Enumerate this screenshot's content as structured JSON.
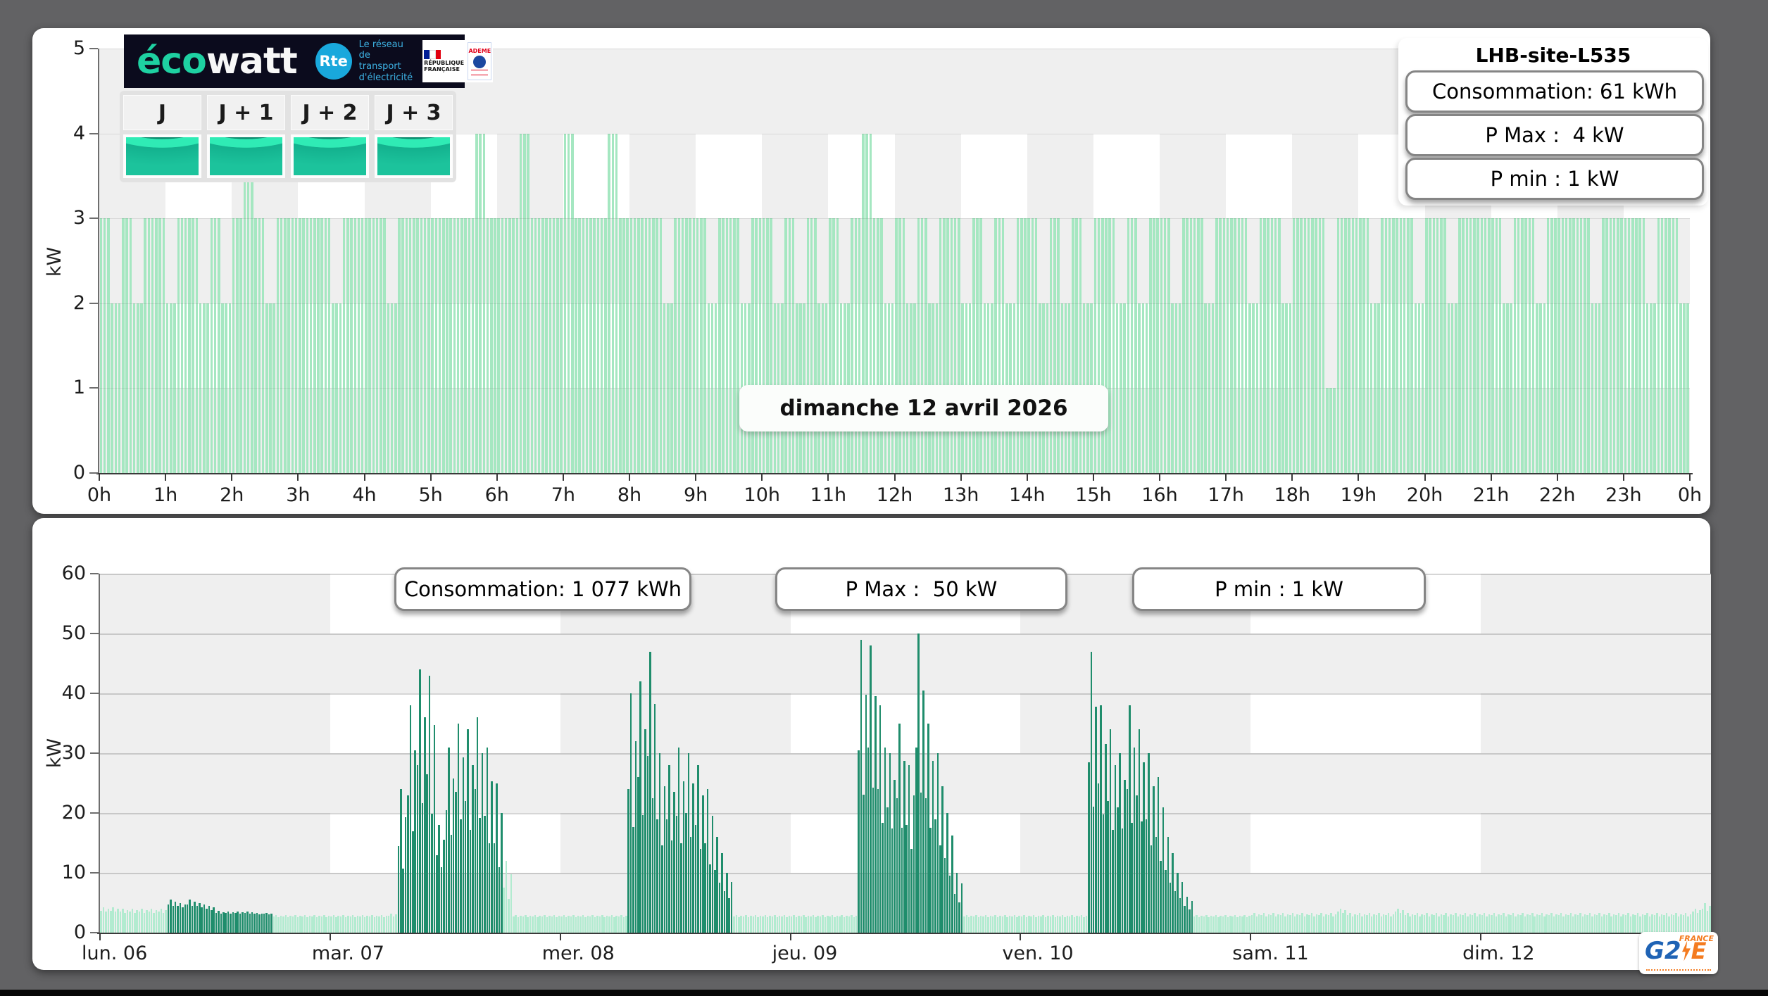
{
  "colors": {
    "checker_gray": "#efefef",
    "accent_teal": "#1ed1a2",
    "rte_blue": "#19a8dc",
    "top_bar_green": "#a5e7c1",
    "light_green": "#b2ebd0",
    "dark_green": "#1f8d6c"
  },
  "logo_banner": {
    "brand_eco": "éco",
    "brand_watt": "watt",
    "rte": "Rte",
    "rte_tagline": "Le réseau\nde transport\nd'électricité",
    "republique": "RÉPUBLIQUE FRANÇAISE",
    "ademe": "ADEME"
  },
  "day_selector": {
    "buttons": [
      "J",
      "J + 1",
      "J + 2",
      "J + 3"
    ]
  },
  "g2e": {
    "g2": "G2",
    "e": "E",
    "france": "FRANCE"
  },
  "chart_data": [
    {
      "type": "bar",
      "title": "LHB-site-L535",
      "annotation": "dimanche 12 avril 2026",
      "ylabel": "kW",
      "ylim": [
        0,
        5
      ],
      "ytick_labels": [
        "5",
        "4",
        "3",
        "2",
        "1",
        "0"
      ],
      "xtick_labels": [
        "0h",
        "1h",
        "2h",
        "3h",
        "4h",
        "5h",
        "6h",
        "7h",
        "8h",
        "9h",
        "10h",
        "11h",
        "12h",
        "13h",
        "14h",
        "15h",
        "16h",
        "17h",
        "18h",
        "19h",
        "20h",
        "21h",
        "22h",
        "23h",
        "0h"
      ],
      "x_step_minutes": 10,
      "bar_color": "#a5e7c1",
      "stats": {
        "consumption": "Consommation: 61 kWh",
        "pmax": "P Max :  4 kW",
        "pmin": "P min : 1 kW"
      },
      "values": [
        3,
        2,
        3,
        2,
        3,
        3,
        2,
        3,
        3,
        2,
        3,
        2,
        3,
        4,
        3,
        2,
        3,
        3,
        3,
        3,
        3,
        2,
        3,
        3,
        3,
        3,
        2,
        3,
        3,
        3,
        3,
        3,
        3,
        3,
        4,
        3,
        3,
        3,
        4,
        3,
        3,
        3,
        4,
        3,
        3,
        3,
        4,
        3,
        3,
        3,
        3,
        2,
        3,
        3,
        3,
        2,
        3,
        3,
        2,
        3,
        3,
        2,
        3,
        2,
        3,
        2,
        3,
        2,
        3,
        4,
        3,
        2,
        3,
        2,
        3,
        2,
        3,
        3,
        2,
        3,
        2,
        3,
        2,
        3,
        3,
        2,
        3,
        2,
        3,
        2,
        3,
        3,
        2,
        3,
        2,
        3,
        3,
        2,
        3,
        3,
        2,
        3,
        3,
        3,
        2,
        3,
        3,
        2,
        3,
        3,
        3,
        1,
        3,
        3,
        3,
        2,
        3,
        3,
        3,
        2,
        3,
        3,
        2,
        3,
        3,
        3,
        3,
        2,
        3,
        3,
        2,
        3,
        3,
        3,
        3,
        2,
        3,
        3,
        3,
        3,
        2,
        3,
        3,
        2
      ]
    },
    {
      "type": "bar",
      "ylabel": "kW",
      "ylim": [
        0,
        60
      ],
      "ytick_labels": [
        "60",
        "50",
        "40",
        "30",
        "20",
        "10",
        "0"
      ],
      "stats": {
        "consumption": "Consommation: 1 077 kWh",
        "pmax": "P Max :  50 kW",
        "pmin": "P min : 1 kW"
      },
      "colors": {
        "light": "#b2ebd0",
        "dark": "#1f8d6c"
      },
      "sub_pattern": [
        0.5,
        1,
        0.3,
        0.75
      ],
      "days": [
        {
          "label": "lun. 06",
          "hours": [
            [
              3.2,
              4.2,
              "L"
            ],
            [
              3.2,
              4.2,
              "L"
            ],
            [
              3,
              4,
              "L"
            ],
            [
              3,
              4,
              "L"
            ],
            [
              3,
              4,
              "L"
            ],
            [
              3,
              4,
              "L"
            ],
            [
              3,
              4,
              "L"
            ],
            [
              4,
              5.5,
              "D"
            ],
            [
              4,
              5,
              "D"
            ],
            [
              4,
              5.5,
              "D"
            ],
            [
              4,
              5,
              "D"
            ],
            [
              3.5,
              4.5,
              "D"
            ],
            [
              3,
              3.6,
              "D"
            ],
            [
              3,
              3.5,
              "D"
            ],
            [
              3,
              3.5,
              "D"
            ],
            [
              3,
              3.5,
              "D"
            ],
            [
              3,
              3.3,
              "D"
            ],
            [
              3,
              3.3,
              "D"
            ],
            [
              2.5,
              3,
              "L"
            ],
            [
              2.5,
              3,
              "L"
            ],
            [
              2.5,
              3,
              "L"
            ],
            [
              2.5,
              3,
              "L"
            ],
            [
              2.5,
              3,
              "L"
            ],
            [
              2.5,
              3,
              "L"
            ]
          ]
        },
        {
          "label": "mar. 07",
          "hours": [
            [
              2.5,
              3,
              "L"
            ],
            [
              2.5,
              3,
              "L"
            ],
            [
              2.5,
              3,
              "L"
            ],
            [
              2.5,
              3,
              "L"
            ],
            [
              2.5,
              3,
              "L"
            ],
            [
              2.5,
              3,
              "L"
            ],
            [
              2.5,
              3.2,
              "L"
            ],
            [
              5,
              24,
              "D"
            ],
            [
              8,
              38,
              "D"
            ],
            [
              12,
              44,
              "D"
            ],
            [
              10,
              43,
              "D"
            ],
            [
              8,
              18,
              "D"
            ],
            [
              10,
              31,
              "D"
            ],
            [
              12,
              35,
              "D"
            ],
            [
              10,
              34,
              "D"
            ],
            [
              12,
              36,
              "D"
            ],
            [
              8,
              31,
              "D"
            ],
            [
              5,
              25,
              "D"
            ],
            [
              3,
              12,
              "L"
            ],
            [
              2.5,
              3,
              "L"
            ],
            [
              2.5,
              3,
              "L"
            ],
            [
              2.5,
              3,
              "L"
            ],
            [
              2.5,
              3,
              "L"
            ],
            [
              2.5,
              3,
              "L"
            ]
          ]
        },
        {
          "label": "mer. 08",
          "hours": [
            [
              2.5,
              3,
              "L"
            ],
            [
              2.5,
              3,
              "L"
            ],
            [
              2.5,
              3,
              "L"
            ],
            [
              2.5,
              3,
              "L"
            ],
            [
              2.5,
              3,
              "L"
            ],
            [
              2.5,
              3,
              "L"
            ],
            [
              2.5,
              3,
              "L"
            ],
            [
              8,
              40,
              "D"
            ],
            [
              10,
              42,
              "D"
            ],
            [
              12,
              47,
              "D"
            ],
            [
              8,
              30,
              "D"
            ],
            [
              10,
              28,
              "D"
            ],
            [
              8,
              31,
              "D"
            ],
            [
              10,
              30,
              "D"
            ],
            [
              8,
              28,
              "D"
            ],
            [
              6,
              24,
              "D"
            ],
            [
              5,
              16,
              "D"
            ],
            [
              4,
              10,
              "D"
            ],
            [
              2.5,
              3,
              "L"
            ],
            [
              2.5,
              3,
              "L"
            ],
            [
              2.5,
              3,
              "L"
            ],
            [
              2.5,
              3,
              "L"
            ],
            [
              2.5,
              3,
              "L"
            ],
            [
              2.5,
              3,
              "L"
            ]
          ]
        },
        {
          "label": "jeu. 09",
          "hours": [
            [
              2.5,
              3,
              "L"
            ],
            [
              2.5,
              3,
              "L"
            ],
            [
              2.5,
              3,
              "L"
            ],
            [
              2.5,
              3,
              "L"
            ],
            [
              2.5,
              3,
              "L"
            ],
            [
              2.5,
              3,
              "L"
            ],
            [
              2.5,
              3,
              "L"
            ],
            [
              12,
              49,
              "D"
            ],
            [
              14,
              48,
              "D"
            ],
            [
              10,
              38,
              "D"
            ],
            [
              12,
              30,
              "D"
            ],
            [
              10,
              35,
              "D"
            ],
            [
              8,
              28,
              "D"
            ],
            [
              12,
              50,
              "D"
            ],
            [
              10,
              35,
              "D"
            ],
            [
              8,
              30,
              "D"
            ],
            [
              5,
              20,
              "D"
            ],
            [
              3,
              10,
              "D"
            ],
            [
              2.5,
              3,
              "L"
            ],
            [
              2.5,
              3,
              "L"
            ],
            [
              2.5,
              3,
              "L"
            ],
            [
              2.5,
              3,
              "L"
            ],
            [
              2.5,
              3,
              "L"
            ],
            [
              2.5,
              3,
              "L"
            ]
          ]
        },
        {
          "label": "ven. 10",
          "hours": [
            [
              2.5,
              3,
              "L"
            ],
            [
              2.5,
              3,
              "L"
            ],
            [
              2.5,
              3,
              "L"
            ],
            [
              2.5,
              3,
              "L"
            ],
            [
              2.5,
              3,
              "L"
            ],
            [
              2.5,
              3,
              "L"
            ],
            [
              2.5,
              3,
              "L"
            ],
            [
              10,
              47,
              "D"
            ],
            [
              12,
              38,
              "D"
            ],
            [
              10,
              34,
              "D"
            ],
            [
              12,
              30,
              "D"
            ],
            [
              10,
              38,
              "D"
            ],
            [
              12,
              34,
              "D"
            ],
            [
              8,
              30,
              "D"
            ],
            [
              6,
              26,
              "D"
            ],
            [
              5,
              16,
              "D"
            ],
            [
              4,
              10,
              "D"
            ],
            [
              3,
              6,
              "D"
            ],
            [
              2.5,
              3,
              "L"
            ],
            [
              2.5,
              3,
              "L"
            ],
            [
              2.5,
              3,
              "L"
            ],
            [
              2.5,
              3,
              "L"
            ],
            [
              2.5,
              3,
              "L"
            ],
            [
              2.5,
              3,
              "L"
            ]
          ]
        },
        {
          "label": "sam. 11",
          "hours": [
            [
              2.5,
              3.3,
              "L"
            ],
            [
              2.5,
              3.3,
              "L"
            ],
            [
              2.5,
              3.3,
              "L"
            ],
            [
              2.5,
              3.3,
              "L"
            ],
            [
              2.5,
              3.3,
              "L"
            ],
            [
              2.5,
              3.3,
              "L"
            ],
            [
              2.5,
              3.3,
              "L"
            ],
            [
              2.5,
              3.3,
              "L"
            ],
            [
              2.5,
              3.3,
              "L"
            ],
            [
              3,
              4,
              "L"
            ],
            [
              2.5,
              3.3,
              "L"
            ],
            [
              2.5,
              3.3,
              "L"
            ],
            [
              2.5,
              3.3,
              "L"
            ],
            [
              2.5,
              3.3,
              "L"
            ],
            [
              2.5,
              3.3,
              "L"
            ],
            [
              3,
              4,
              "L"
            ],
            [
              2.5,
              3.3,
              "L"
            ],
            [
              2.5,
              3.3,
              "L"
            ],
            [
              2.5,
              3.3,
              "L"
            ],
            [
              2.5,
              3.3,
              "L"
            ],
            [
              2.5,
              3.3,
              "L"
            ],
            [
              2.5,
              3.3,
              "L"
            ],
            [
              2.5,
              3.3,
              "L"
            ],
            [
              2.5,
              3.3,
              "L"
            ]
          ]
        },
        {
          "label": "dim. 12",
          "hours": [
            [
              2.5,
              3.3,
              "L"
            ],
            [
              2.5,
              3.3,
              "L"
            ],
            [
              2.5,
              3.3,
              "L"
            ],
            [
              2.5,
              3.3,
              "L"
            ],
            [
              2.5,
              3.3,
              "L"
            ],
            [
              2.5,
              3.3,
              "L"
            ],
            [
              2.5,
              3.3,
              "L"
            ],
            [
              2.5,
              3.3,
              "L"
            ],
            [
              2.5,
              3.3,
              "L"
            ],
            [
              2.5,
              3.3,
              "L"
            ],
            [
              2.5,
              3.3,
              "L"
            ],
            [
              2.5,
              3.3,
              "L"
            ],
            [
              2.5,
              3.3,
              "L"
            ],
            [
              2.5,
              3.3,
              "L"
            ],
            [
              2.5,
              3.3,
              "L"
            ],
            [
              2.5,
              3.3,
              "L"
            ],
            [
              2.5,
              3.3,
              "L"
            ],
            [
              2.5,
              3.3,
              "L"
            ],
            [
              2.5,
              3.3,
              "L"
            ],
            [
              2.5,
              3.3,
              "L"
            ],
            [
              2.5,
              3.3,
              "L"
            ],
            [
              2.5,
              3.3,
              "L"
            ],
            [
              3,
              4,
              "L"
            ],
            [
              3,
              5,
              "L"
            ]
          ]
        }
      ]
    }
  ]
}
